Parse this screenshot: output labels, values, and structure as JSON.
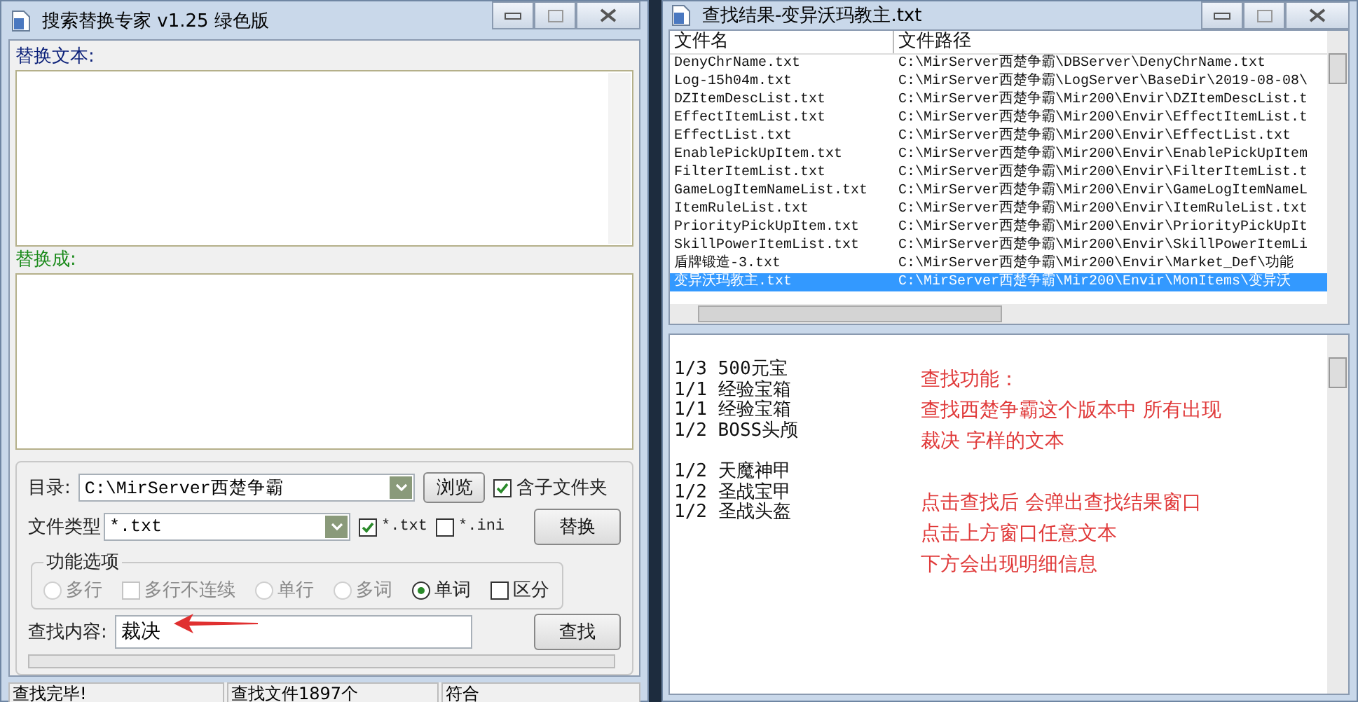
{
  "search_window": {
    "title": "搜索替换专家 v1.25  绿色版",
    "replace_text_label": "替换文本:",
    "replace_with_label": "替换成:",
    "directory": {
      "label": "目录:",
      "value": "C:\\MirServer西楚争霸"
    },
    "browse_button": "浏览",
    "include_subfolders": {
      "label": "含子文件夹",
      "checked": true
    },
    "file_type": {
      "label": "文件类型",
      "value": "*.txt"
    },
    "type_filters": [
      {
        "label": "*.txt",
        "checked": true
      },
      {
        "label": "*.ini",
        "checked": false
      }
    ],
    "replace_button": "替换",
    "options": {
      "title": "功能选项",
      "items": [
        {
          "kind": "radio",
          "label": "多行",
          "selected": false,
          "disabled": true
        },
        {
          "kind": "checkbox",
          "label": "多行不连续",
          "checked": false,
          "disabled": true
        },
        {
          "kind": "radio",
          "label": "单行",
          "selected": false,
          "disabled": true
        },
        {
          "kind": "radio",
          "label": "多词",
          "selected": false,
          "disabled": true
        },
        {
          "kind": "radio",
          "label": "单词",
          "selected": true,
          "disabled": false
        },
        {
          "kind": "checkbox",
          "label": "区分",
          "checked": false,
          "disabled": false
        }
      ]
    },
    "search_content": {
      "label": "查找内容:",
      "value": "裁决"
    },
    "search_button": "查找",
    "progress": {
      "level": 0
    },
    "status_bar": [
      "查找完毕!",
      "查找文件1897个",
      "符合"
    ]
  },
  "results_window": {
    "title": "查找结果-变异沃玛教主.txt",
    "columns": [
      "文件名",
      "文件路径"
    ],
    "rows": [
      {
        "name": "DenyChrName.txt",
        "path": "C:\\MirServer西楚争霸\\DBServer\\DenyChrName.txt",
        "selected": false
      },
      {
        "name": "Log-15h04m.txt",
        "path": "C:\\MirServer西楚争霸\\LogServer\\BaseDir\\2019-08-08\\",
        "selected": false
      },
      {
        "name": "DZItemDescList.txt",
        "path": "C:\\MirServer西楚争霸\\Mir200\\Envir\\DZItemDescList.t",
        "selected": false
      },
      {
        "name": "EffectItemList.txt",
        "path": "C:\\MirServer西楚争霸\\Mir200\\Envir\\EffectItemList.t",
        "selected": false
      },
      {
        "name": "EffectList.txt",
        "path": "C:\\MirServer西楚争霸\\Mir200\\Envir\\EffectList.txt",
        "selected": false
      },
      {
        "name": "EnablePickUpItem.txt",
        "path": "C:\\MirServer西楚争霸\\Mir200\\Envir\\EnablePickUpItem",
        "selected": false
      },
      {
        "name": "FilterItemList.txt",
        "path": "C:\\MirServer西楚争霸\\Mir200\\Envir\\FilterItemList.t",
        "selected": false
      },
      {
        "name": "GameLogItemNameList.txt",
        "path": "C:\\MirServer西楚争霸\\Mir200\\Envir\\GameLogItemNameL",
        "selected": false
      },
      {
        "name": "ItemRuleList.txt",
        "path": "C:\\MirServer西楚争霸\\Mir200\\Envir\\ItemRuleList.txt",
        "selected": false
      },
      {
        "name": "PriorityPickUpItem.txt",
        "path": "C:\\MirServer西楚争霸\\Mir200\\Envir\\PriorityPickUpIt",
        "selected": false
      },
      {
        "name": "SkillPowerItemList.txt",
        "path": "C:\\MirServer西楚争霸\\Mir200\\Envir\\SkillPowerItemLi",
        "selected": false
      },
      {
        "name": "盾牌锻造-3.txt",
        "path": "C:\\MirServer西楚争霸\\Mir200\\Envir\\Market_Def\\功能",
        "selected": false
      },
      {
        "name": "变异沃玛教主.txt",
        "path": "C:\\MirServer西楚争霸\\Mir200\\Envir\\MonItems\\变异沃",
        "selected": true
      }
    ],
    "detail_groups": [
      [
        "1/3 500元宝",
        "1/1 经验宝箱",
        "1/1 经验宝箱",
        "1/2 BOSS头颅"
      ],
      [
        "1/2 天魔神甲",
        "1/2 圣战宝甲",
        "1/2 圣战头盔"
      ]
    ],
    "note_groups": [
      [
        "查找功能：",
        "查找西楚争霸这个版本中 所有出现",
        "裁决 字样的文本"
      ],
      [
        "点击查找后 会弹出查找结果窗口",
        "点击上方窗口任意文本",
        "下方会出现明细信息"
      ]
    ]
  }
}
